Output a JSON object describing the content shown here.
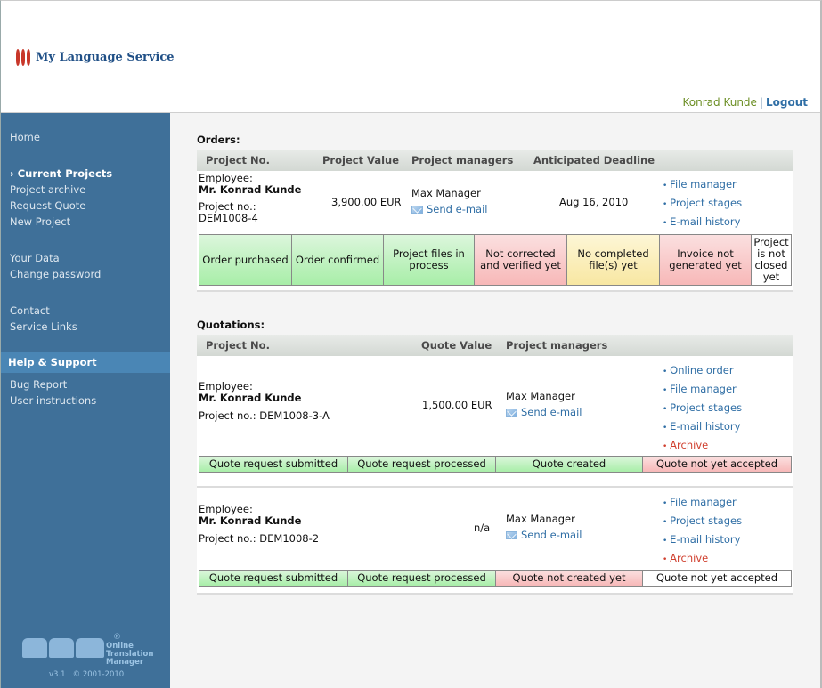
{
  "header": {
    "logo_text": "My Language Service",
    "user_name": "Konrad Kunde",
    "separator": "|",
    "logout_label": "Logout"
  },
  "sidebar": {
    "items": [
      {
        "label": "Home"
      },
      {
        "label": "› Current Projects",
        "active": true
      },
      {
        "label": "Project archive"
      },
      {
        "label": "Request Quote"
      },
      {
        "label": "New Project"
      },
      {
        "label": "Your Data"
      },
      {
        "label": "Change password"
      },
      {
        "label": "Contact"
      },
      {
        "label": "Service Links"
      },
      {
        "label": "Bug Report"
      },
      {
        "label": "User instructions"
      }
    ],
    "section_help": "Help & Support",
    "footer": {
      "reg": "®",
      "product_line1": "Online",
      "product_line2": "Translation",
      "product_line3": "Manager",
      "version": "v3.1   © 2001-2010"
    }
  },
  "orders": {
    "title": "Orders:",
    "columns": [
      "Project No.",
      "Project Value",
      "Project managers",
      "Anticipated Deadline"
    ],
    "rows": [
      {
        "employee_label": "Employee:",
        "employee_name": "Mr. Konrad Kunde",
        "project_label": "Project no.:",
        "project_no": "DEM1008-4",
        "value": "3,900.00 EUR",
        "manager": "Max Manager",
        "send_email": "Send e-mail",
        "deadline": "Aug 16, 2010",
        "links": [
          "File manager",
          "Project stages",
          "E-mail history"
        ],
        "stages": [
          {
            "label": "Order purchased",
            "status": "done"
          },
          {
            "label": "Order confirmed",
            "status": "done"
          },
          {
            "label": "Project files in process",
            "status": "done"
          },
          {
            "label": "Not corrected and verified yet",
            "status": "pending"
          },
          {
            "label": "No completed file(s) yet",
            "status": "in-progress"
          },
          {
            "label": "Invoice not generated yet",
            "status": "pending"
          },
          {
            "label": "Project is not closed yet",
            "status": "none"
          }
        ]
      }
    ]
  },
  "quotations": {
    "title": "Quotations:",
    "columns": [
      "Project No.",
      "Quote Value",
      "Project managers"
    ],
    "rows": [
      {
        "employee_label": "Employee:",
        "employee_name": "Mr. Konrad Kunde",
        "project_label": "Project no.: DEM1008-3-A",
        "value": "1,500.00 EUR",
        "manager": "Max Manager",
        "send_email": "Send e-mail",
        "links": [
          "Online order",
          "File manager",
          "Project stages",
          "E-mail history",
          "Archive"
        ],
        "stages": [
          {
            "label": "Quote request submitted",
            "status": "done"
          },
          {
            "label": "Quote request processed",
            "status": "done"
          },
          {
            "label": "Quote created",
            "status": "done"
          },
          {
            "label": "Quote not yet accepted",
            "status": "pending"
          }
        ]
      },
      {
        "employee_label": "Employee:",
        "employee_name": "Mr. Konrad Kunde",
        "project_label": "Project no.: DEM1008-2",
        "value": "n/a",
        "manager": "Max Manager",
        "send_email": "Send e-mail",
        "links": [
          "File manager",
          "Project stages",
          "E-mail history",
          "Archive"
        ],
        "stages": [
          {
            "label": "Quote request submitted",
            "status": "done"
          },
          {
            "label": "Quote request processed",
            "status": "done"
          },
          {
            "label": "Quote not created yet",
            "status": "pending"
          },
          {
            "label": "Quote not yet accepted",
            "status": "none"
          }
        ]
      }
    ]
  },
  "colors": {
    "sidebar": "#3f7099",
    "sidebar_section": "#4a86b5",
    "link": "#2f6ea5",
    "archive_link": "#d0402f",
    "stage_done": "#a8eea8",
    "stage_pending": "#f7b8b8",
    "stage_in_progress": "#f8e7a2",
    "logo_red": "#c8372a",
    "logo_blue": "#1f4f86",
    "user_name": "#6b8e23"
  }
}
